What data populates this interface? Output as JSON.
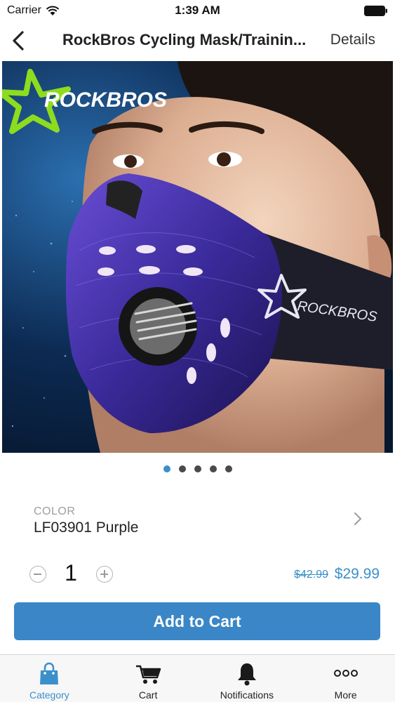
{
  "status_bar": {
    "carrier": "Carrier",
    "time": "1:39 AM"
  },
  "nav": {
    "title": "RockBros Cycling Mask/Trainin...",
    "details_label": "Details"
  },
  "product_image": {
    "brand_logo_text": "ROCKBROS",
    "mask_logo_text": "ROCKBROS",
    "page_count": 5,
    "active_page": 1
  },
  "color": {
    "label": "COLOR",
    "value": "LF03901 Purple"
  },
  "quantity": {
    "value": "1"
  },
  "price": {
    "original": "$42.99",
    "sale": "$29.99"
  },
  "add_to_cart_label": "Add to Cart",
  "tabs": [
    {
      "label": "Category",
      "icon": "shopping-bag-icon",
      "active": true
    },
    {
      "label": "Cart",
      "icon": "cart-icon",
      "active": false
    },
    {
      "label": "Notifications",
      "icon": "bell-icon",
      "active": false
    },
    {
      "label": "More",
      "icon": "more-icon",
      "active": false
    }
  ],
  "colors": {
    "accent": "#3b8fcb",
    "button": "#3b86c6",
    "tab_bar_bg": "#f7f7f7"
  }
}
